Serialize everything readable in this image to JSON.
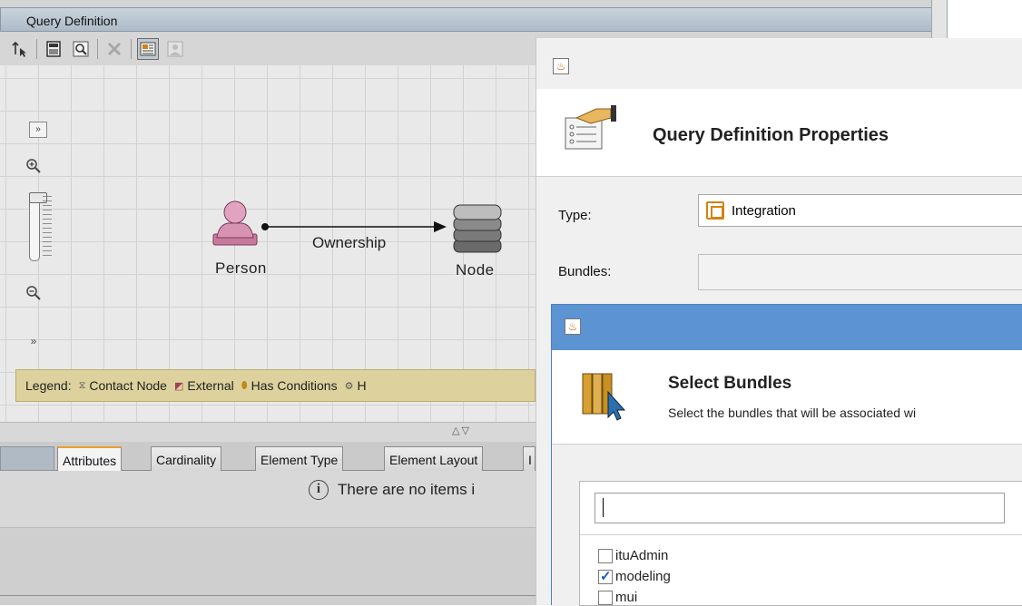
{
  "editor": {
    "title": "Query Definition",
    "toolbar": [
      "select-arrow-icon",
      "calculator-icon",
      "find-icon",
      "delete-icon",
      "properties-icon",
      "user-icon"
    ],
    "nodes": [
      {
        "label": "Person"
      },
      {
        "label": "Node"
      }
    ],
    "edge_label": "Ownership",
    "legend": {
      "prefix": "Legend:",
      "items": [
        "Contact Node",
        "External",
        "Has Conditions",
        "H"
      ]
    },
    "tabs": [
      "Attributes",
      "Cardinality",
      "Element Type",
      "Element Layout",
      "I"
    ],
    "active_tab": "Attributes",
    "empty_message": "There are no items i"
  },
  "properties_dialog": {
    "title": "Query Definition Properties",
    "type_label": "Type:",
    "type_value": "Integration",
    "bundles_label": "Bundles:"
  },
  "bundles_dialog": {
    "title": "Select Bundles",
    "subtitle": "Select the bundles that will be associated wi",
    "search_value": "",
    "items": [
      {
        "label": "ituAdmin",
        "checked": false
      },
      {
        "label": "modeling",
        "checked": true
      },
      {
        "label": "mui",
        "checked": false
      }
    ]
  },
  "colors": {
    "legend_bg": "#ddd29d",
    "titlebar_blue": "#5b93d3",
    "person_pink": "#c87a9c",
    "active_tab_accent": "#e8a030"
  }
}
